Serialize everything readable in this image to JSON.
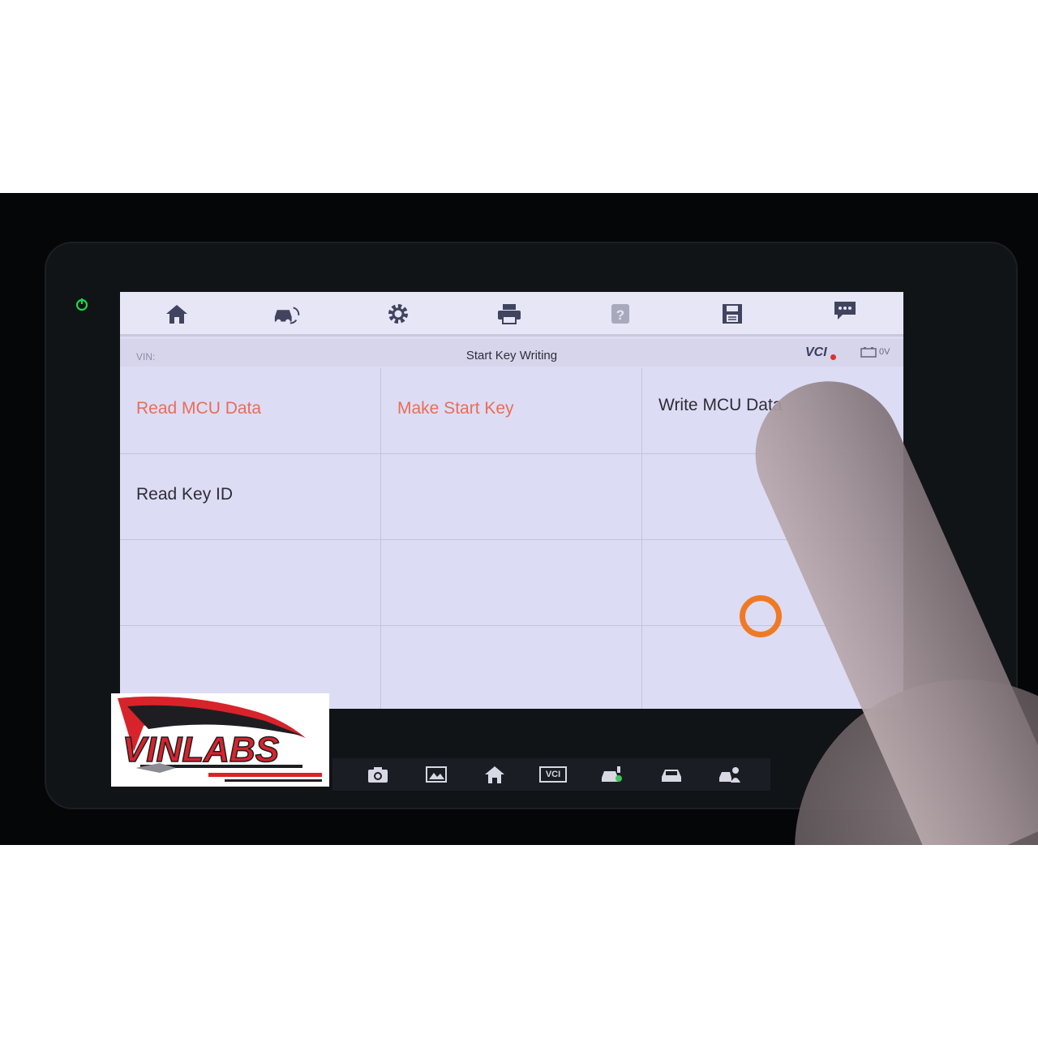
{
  "toolbar": {
    "icons": [
      "home-icon",
      "car-swap-icon",
      "gear-icon",
      "printer-icon",
      "help-icon",
      "save-icon",
      "message-icon"
    ]
  },
  "status": {
    "vin_label": "VIN:",
    "title": "Start Key Writing",
    "vci_label": "VCI",
    "voltage": "0V"
  },
  "grid": {
    "items": [
      {
        "label": "Read MCU Data",
        "color": "#ea6d55"
      },
      {
        "label": "Make Start Key",
        "color": "#ea6d55"
      },
      {
        "label": "Write MCU Data",
        "color": "#2d2d36"
      },
      {
        "label": "Read Key ID",
        "color": "#2d2d36"
      }
    ]
  },
  "taskbar": {
    "icons": [
      "camera-icon",
      "screenshot-icon",
      "home-icon",
      "vci-icon",
      "car-diagnostic-icon",
      "car-icon",
      "car-user-icon"
    ],
    "vci_text": "VCI"
  },
  "logo": {
    "text": "VINLABS"
  },
  "colors": {
    "accent_orange": "#ea6d55",
    "power_green": "#22d34a",
    "logo_red": "#d8232a"
  }
}
